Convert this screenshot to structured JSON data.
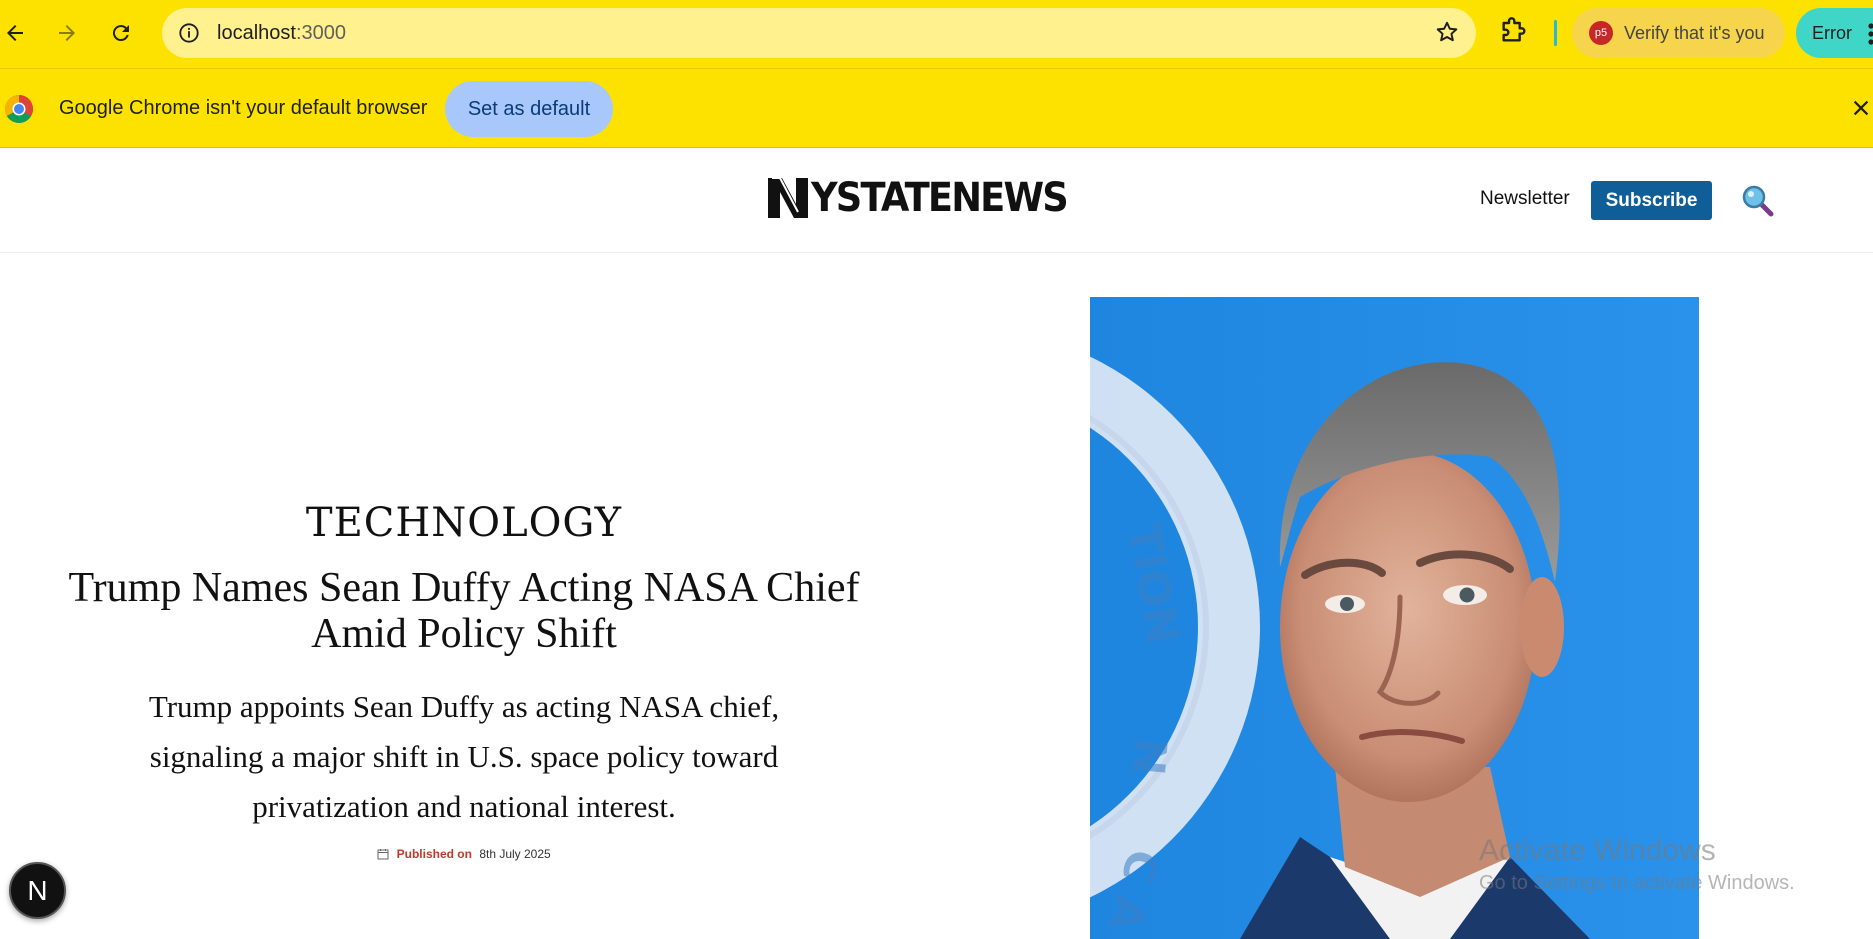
{
  "browser": {
    "url_host": "localhost",
    "url_port": ":3000",
    "profile_initials": "p5",
    "verify_label": "Verify that it's you",
    "error_label": "Error",
    "icons": [
      "back-icon",
      "forward-icon",
      "reload-icon",
      "info-icon",
      "star-icon",
      "extensions-icon",
      "menu-icon"
    ]
  },
  "infobar": {
    "message": "Google Chrome isn't your default browser",
    "set_default_label": "Set as default"
  },
  "site": {
    "logo_text": "YSTATENEWS",
    "logo_letter": "N",
    "newsletter_label": "Newsletter",
    "subscribe_label": "Subscribe",
    "colors": {
      "subscribe": "#0f5e97",
      "published": "#c0392b"
    }
  },
  "article": {
    "category": "TECHNOLOGY",
    "headline": "Trump Names Sean Duffy Acting NASA Chief Amid Policy Shift",
    "summary": "Trump appoints Sean Duffy as acting NASA chief, signaling a major shift in U.S. space policy toward privatization and national interest.",
    "published_label": "Published on",
    "published_date": "8th July 2025"
  },
  "overlays": {
    "next_badge": "N",
    "watermark_title": "Activate Windows",
    "watermark_sub": "Go to Settings to activate Windows."
  }
}
